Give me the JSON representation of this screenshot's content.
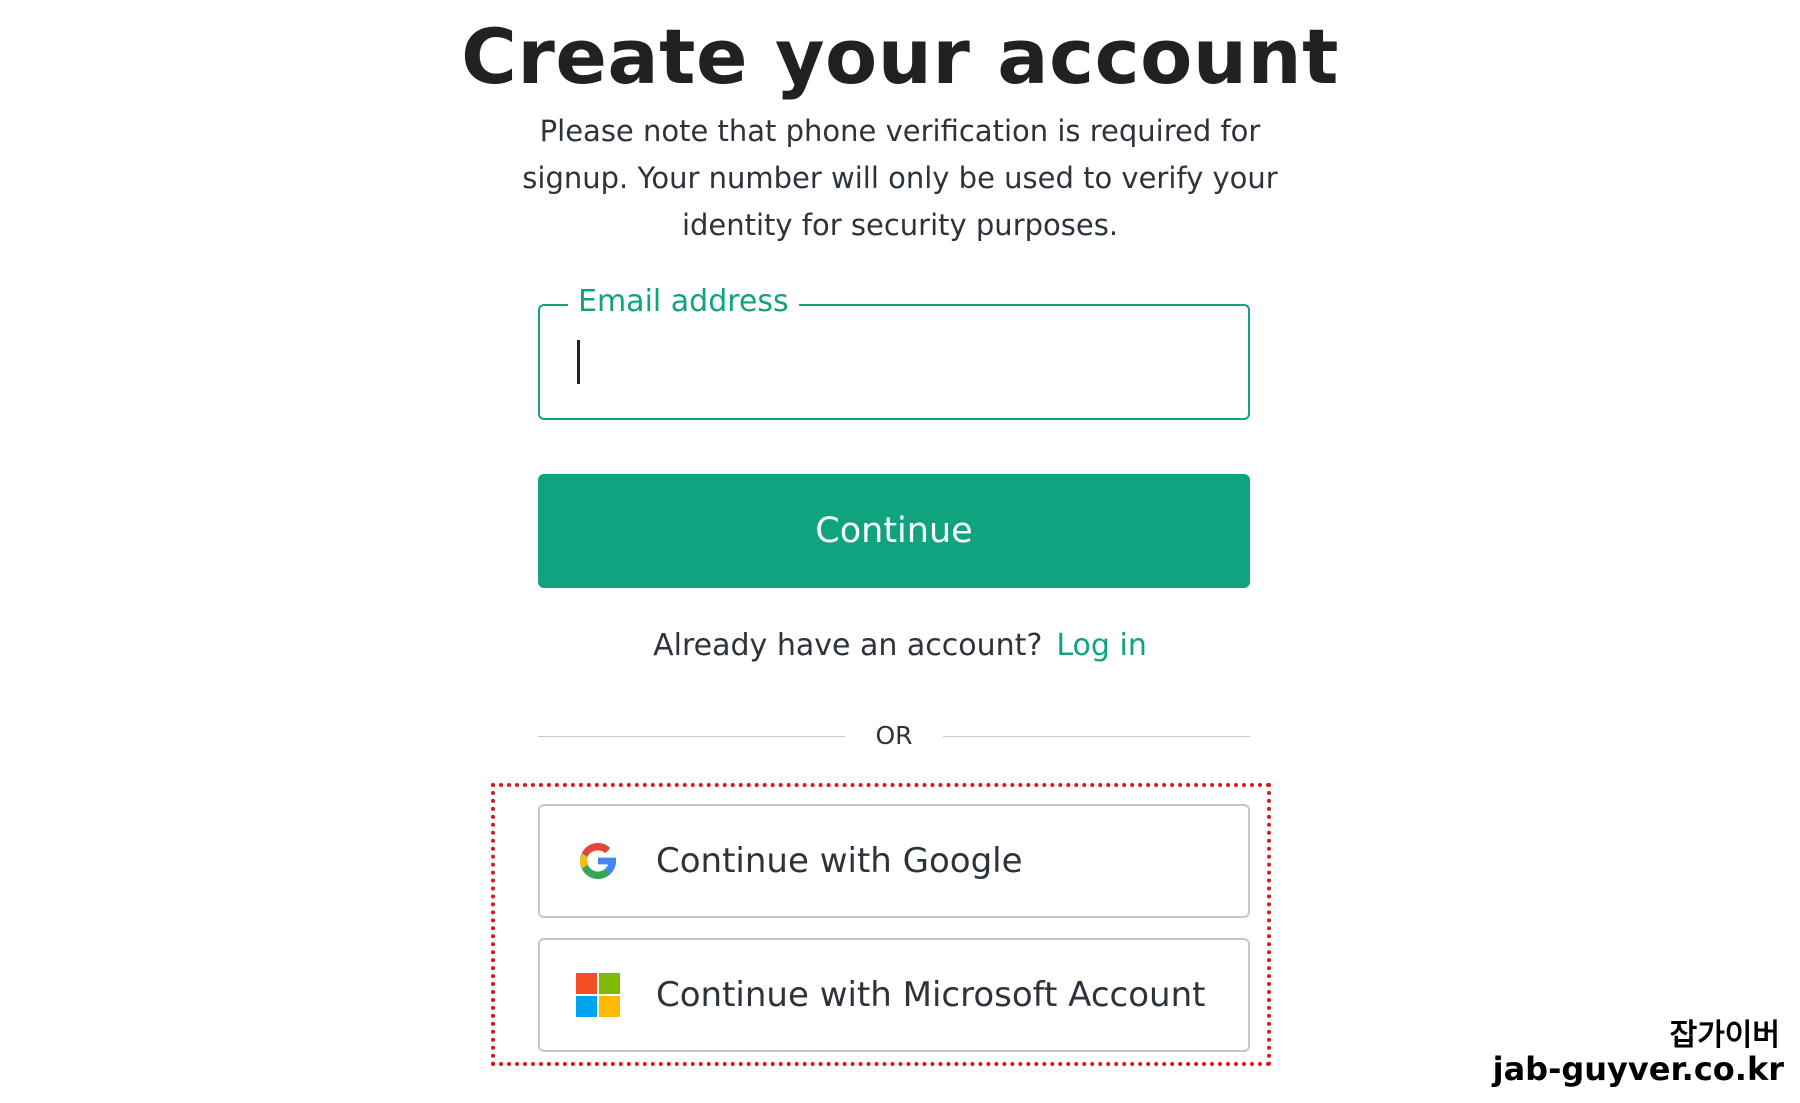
{
  "header": {
    "title": "Create your account",
    "subtitle": "Please note that phone verification is required for signup. Your number will only be used to verify your identity for security purposes."
  },
  "email_field": {
    "label": "Email address",
    "value": "",
    "placeholder": ""
  },
  "continue_button": {
    "label": "Continue"
  },
  "login_prompt": {
    "text": "Already have an account?",
    "link_label": "Log in"
  },
  "divider": {
    "label": "OR"
  },
  "social": {
    "google_label": "Continue with Google",
    "microsoft_label": "Continue with Microsoft Account",
    "google_icon": "google-g-icon",
    "microsoft_icon": "microsoft-logo-icon"
  },
  "watermark": {
    "korean": "잡가이버",
    "url": "jab-guyver.co.kr"
  },
  "colors": {
    "accent": "#10a37f",
    "highlight": "#e0141e",
    "border": "#c2c8d0"
  }
}
